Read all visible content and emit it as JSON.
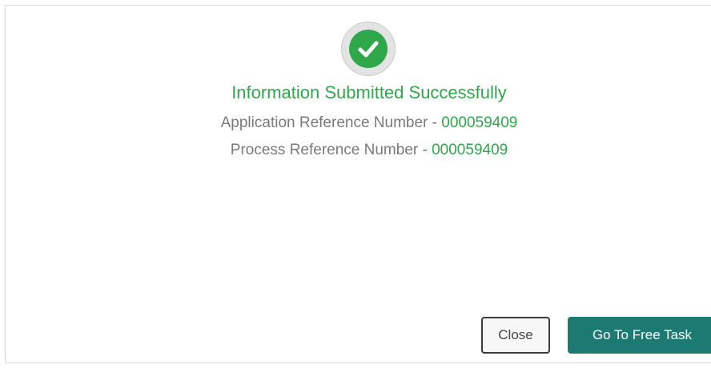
{
  "dialog": {
    "status_icon": "check-circle-icon",
    "title": "Information Submitted Successfully",
    "application_ref": {
      "label": "Application Reference Number - ",
      "value": "000059409"
    },
    "process_ref": {
      "label": "Process Reference Number - ",
      "value": "000059409"
    }
  },
  "buttons": {
    "close_label": "Close",
    "free_task_label": "Go To Free Task"
  },
  "colors": {
    "success": "#2ea84a",
    "primary_button": "#1d7a73",
    "muted_text": "#7a7a7a"
  }
}
